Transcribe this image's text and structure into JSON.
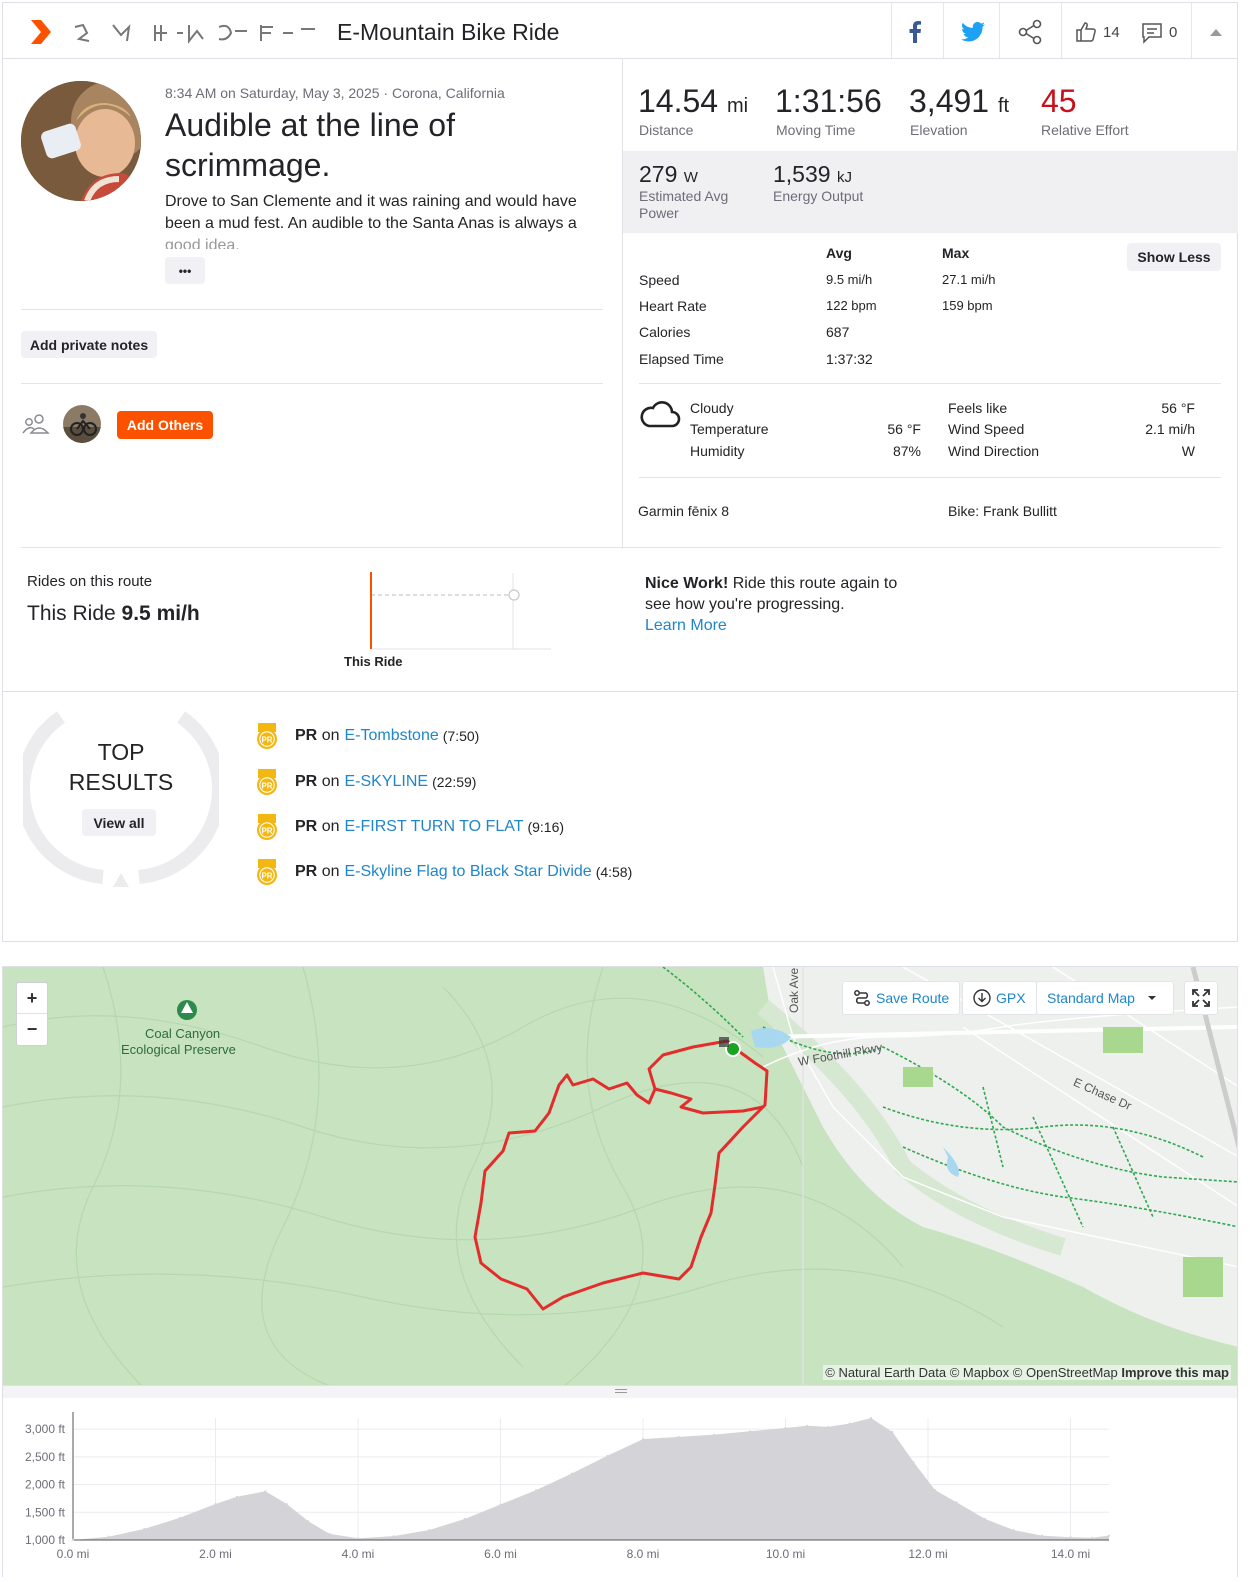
{
  "header": {
    "title": "E-Mountain Bike Ride",
    "kudos_count": "14",
    "comment_count": "0"
  },
  "activity": {
    "meta": "8:34 AM on Saturday, May 3, 2025 · Corona, California",
    "title_line1": "Audible at the line of",
    "title_line2": "scrimmage.",
    "desc_line1": "Drove to San Clemente and it was raining and would have",
    "desc_line2": "been a mud fest. An audible to the Santa Anas is always a",
    "desc_line3": "good idea.",
    "more_label": "•••",
    "private_notes_label": "Add private notes",
    "add_others_label": "Add Others"
  },
  "stats": {
    "distance": {
      "value": "14.54",
      "unit": "mi",
      "label": "Distance"
    },
    "moving_time": {
      "value": "1:31:56",
      "label": "Moving Time"
    },
    "elevation": {
      "value": "3,491",
      "unit": "ft",
      "label": "Elevation"
    },
    "relative_effort": {
      "value": "45",
      "label": "Relative Effort"
    },
    "power": {
      "value": "279",
      "unit": "W",
      "label_line1": "Estimated Avg",
      "label_line2": "Power"
    },
    "energy": {
      "value": "1,539",
      "unit": "kJ",
      "label": "Energy Output"
    }
  },
  "details": {
    "avg_header": "Avg",
    "max_header": "Max",
    "show_less_label": "Show Less",
    "rows": [
      {
        "label": "Speed",
        "avg": "9.5 mi/h",
        "max": "27.1 mi/h"
      },
      {
        "label": "Heart Rate",
        "avg": "122 bpm",
        "max": "159 bpm"
      },
      {
        "label": "Calories",
        "avg": "687",
        "max": ""
      },
      {
        "label": "Elapsed Time",
        "avg": "1:37:32",
        "max": ""
      }
    ]
  },
  "weather": {
    "condition": "Cloudy",
    "temperature_label": "Temperature",
    "temperature_value": "56 °F",
    "humidity_label": "Humidity",
    "humidity_value": "87%",
    "feels_like_label": "Feels like",
    "feels_like_value": "56 °F",
    "wind_speed_label": "Wind Speed",
    "wind_speed_value": "2.1 mi/h",
    "wind_direction_label": "Wind Direction",
    "wind_direction_value": "W"
  },
  "gear": {
    "device": "Garmin fēnix 8",
    "bike": "Bike: Frank Bullitt"
  },
  "route_compare": {
    "heading": "Rides on this route",
    "this_ride_prefix": "This Ride",
    "this_ride_speed": "9.5 mi/h",
    "bar_label": "This Ride",
    "nice_work_bold": "Nice Work!",
    "nice_work_rest": " Ride this route again to",
    "nice_work_line2": "see how you're progressing.",
    "learn_more": "Learn More"
  },
  "top_results": {
    "heading_line1": "TOP",
    "heading_line2": "RESULTS",
    "view_all": "View all",
    "pr_label": "PR",
    "on_label": "on",
    "medal_text": "PR",
    "items": [
      {
        "segment": "E-Tombstone",
        "time": "(7:50)"
      },
      {
        "segment": "E-SKYLINE",
        "time": "(22:59)"
      },
      {
        "segment": "E-FIRST TURN TO FLAT",
        "time": "(9:16)"
      },
      {
        "segment": "E-Skyline Flag to Black Star Divide",
        "time": "(4:58)"
      }
    ]
  },
  "map": {
    "zoom_in": "+",
    "zoom_out": "−",
    "save_route": "Save Route",
    "gpx": "GPX",
    "map_type": "Standard Map",
    "poi_line1": "Coal Canyon",
    "poi_line2": "Ecological Preserve",
    "road_oak": "Oak Ave",
    "road_foothill": "W Foothill Pkwy",
    "road_chase": "E Chase Dr",
    "attribution": "© Natural Earth Data © Mapbox © OpenStreetMap",
    "improve": "Improve this map"
  },
  "elevation_chart": {
    "y_ticks": [
      "3,000 ft",
      "2,500 ft",
      "2,000 ft",
      "1,500 ft",
      "1,000 ft"
    ],
    "x_ticks": [
      "0.0 mi",
      "2.0 mi",
      "4.0 mi",
      "6.0 mi",
      "8.0 mi",
      "10.0 mi",
      "12.0 mi",
      "14.0 mi"
    ]
  },
  "chart_data": {
    "type": "area",
    "x": [
      0.0,
      0.5,
      1.0,
      1.5,
      2.0,
      2.3,
      2.7,
      3.0,
      3.3,
      3.6,
      4.0,
      4.5,
      5.0,
      5.5,
      6.0,
      6.5,
      7.0,
      7.5,
      8.0,
      8.5,
      9.0,
      9.5,
      10.0,
      10.3,
      10.6,
      10.9,
      11.2,
      11.5,
      11.8,
      12.1,
      12.4,
      12.8,
      13.2,
      13.6,
      14.0,
      14.3,
      14.54
    ],
    "y": [
      1000,
      1060,
      1200,
      1400,
      1650,
      1780,
      1880,
      1650,
      1340,
      1110,
      1030,
      1070,
      1180,
      1380,
      1640,
      1900,
      2200,
      2520,
      2820,
      2860,
      2900,
      2960,
      3020,
      3060,
      3040,
      3100,
      3200,
      2950,
      2400,
      1900,
      1680,
      1380,
      1180,
      1080,
      1050,
      1040,
      1080
    ],
    "xlabel": "",
    "ylabel": "",
    "xlim": [
      0,
      14.54
    ],
    "ylim": [
      1000,
      3200
    ],
    "grid": true
  },
  "colors": {
    "brand": "#fc5200",
    "link": "#1f86c9",
    "effort": "#c7101c",
    "route": "#e32c2c",
    "medal": "#f3b711",
    "facebook": "#3b5998",
    "twitter": "#1da1f2"
  }
}
